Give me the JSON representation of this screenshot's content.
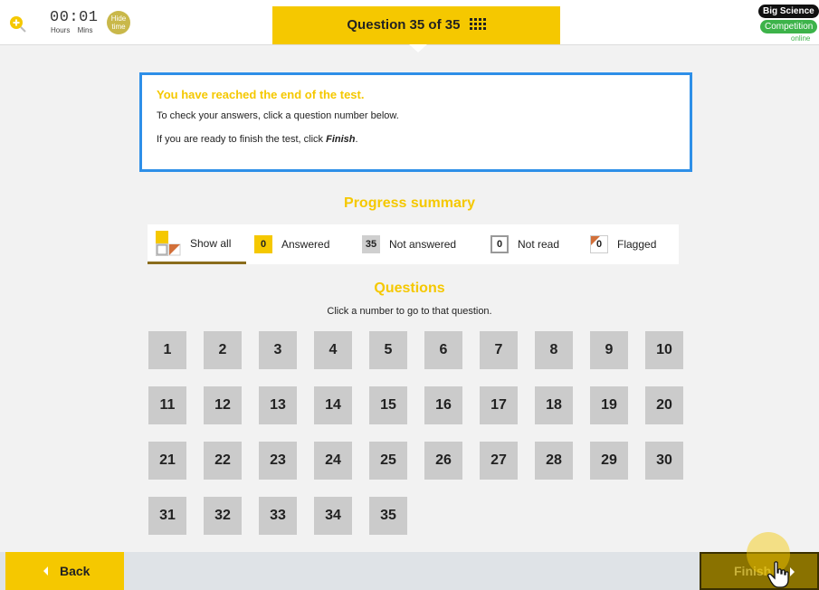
{
  "header": {
    "timer": "00:01",
    "timer_hours_label": "Hours",
    "timer_mins_label": "Mins",
    "hide_time_line1": "Hide",
    "hide_time_line2": "time",
    "question_indicator": "Question 35 of 35",
    "logo_line1": "Big Science",
    "logo_line2": "Competition",
    "logo_line3": "online"
  },
  "info": {
    "title": "You have reached the end of the test.",
    "line1": "To check your answers, click a question number below.",
    "line2_prefix": "If you are ready to finish the test, click ",
    "line2_action": "Finish",
    "line2_suffix": "."
  },
  "progress": {
    "title": "Progress summary",
    "filters": [
      {
        "label": "Show all",
        "active": true
      },
      {
        "count": "0",
        "label": "Answered"
      },
      {
        "count": "35",
        "label": "Not answered"
      },
      {
        "count": "0",
        "label": "Not read"
      },
      {
        "count": "0",
        "label": "Flagged"
      }
    ]
  },
  "questions": {
    "title": "Questions",
    "subtitle": "Click a number to go to that question.",
    "numbers": [
      "1",
      "2",
      "3",
      "4",
      "5",
      "6",
      "7",
      "8",
      "9",
      "10",
      "11",
      "12",
      "13",
      "14",
      "15",
      "16",
      "17",
      "18",
      "19",
      "20",
      "21",
      "22",
      "23",
      "24",
      "25",
      "26",
      "27",
      "28",
      "29",
      "30",
      "31",
      "32",
      "33",
      "34",
      "35"
    ]
  },
  "footer": {
    "back_label": "Back",
    "finish_label": "Finish"
  },
  "colors": {
    "accent": "#f5c800",
    "info_border": "#2e8fe8",
    "question_button": "#cbcbcb",
    "finish_background": "#8a7200"
  }
}
